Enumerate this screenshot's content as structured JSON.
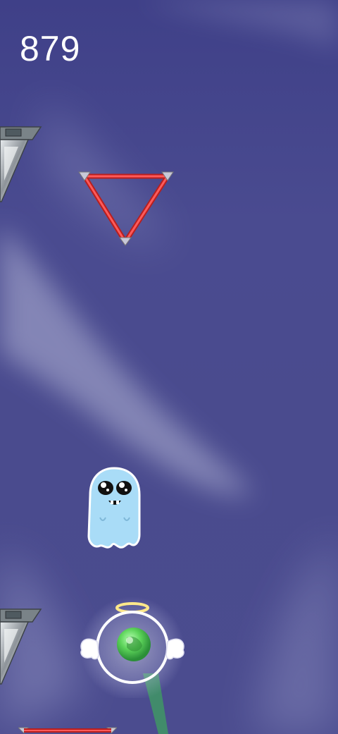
{
  "hud": {
    "score": "879"
  },
  "colors": {
    "sky": "#4a4b8f",
    "laser": "#e23838",
    "ghost": "#a9dcf7",
    "orb": "#6ddc6a",
    "halo": "#ffe88a"
  },
  "sprites": {
    "player": "ghost-player",
    "hazard": "laser-triangle",
    "obstacle": "metal-spike-wall",
    "pickup": "angel-orb-powerup"
  }
}
